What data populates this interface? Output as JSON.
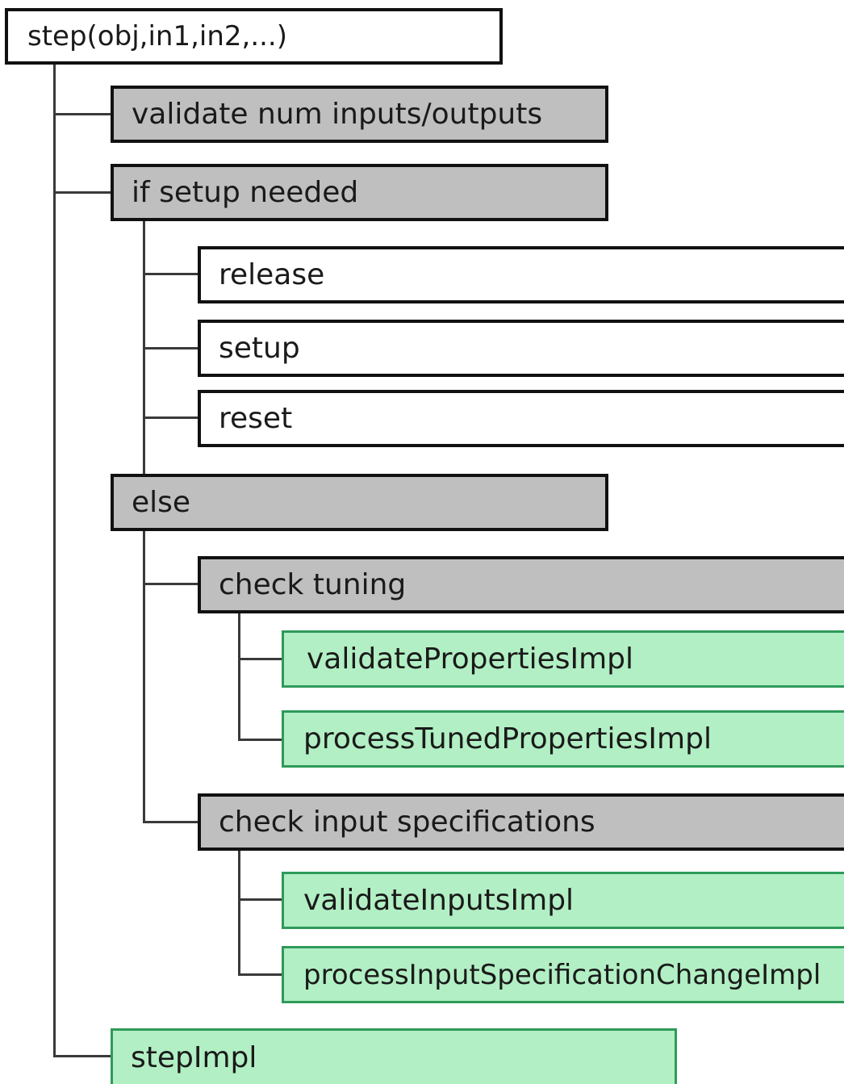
{
  "diagram": {
    "nodes": {
      "root": "step(obj,in1,in2,...)",
      "validate_num": "validate num inputs/outputs",
      "if_setup": "if setup needed",
      "release": "release",
      "setup": "setup",
      "reset": "reset",
      "else": "else",
      "check_tuning": "check tuning",
      "validate_properties": "validatePropertiesImpl",
      "process_tuned": "processTunedPropertiesImpl",
      "check_input_specs": "check input specifications",
      "validate_inputs": "validateInputsImpl",
      "process_input_spec": "processInputSpecificationChangeImpl",
      "step_impl": "stepImpl"
    },
    "colors": {
      "plain_node": "#ffffff",
      "control_node": "#bfbfbf",
      "impl_node": "#b2efc4",
      "impl_border": "#2f9a5a",
      "connector": "#3a3a3a"
    }
  }
}
